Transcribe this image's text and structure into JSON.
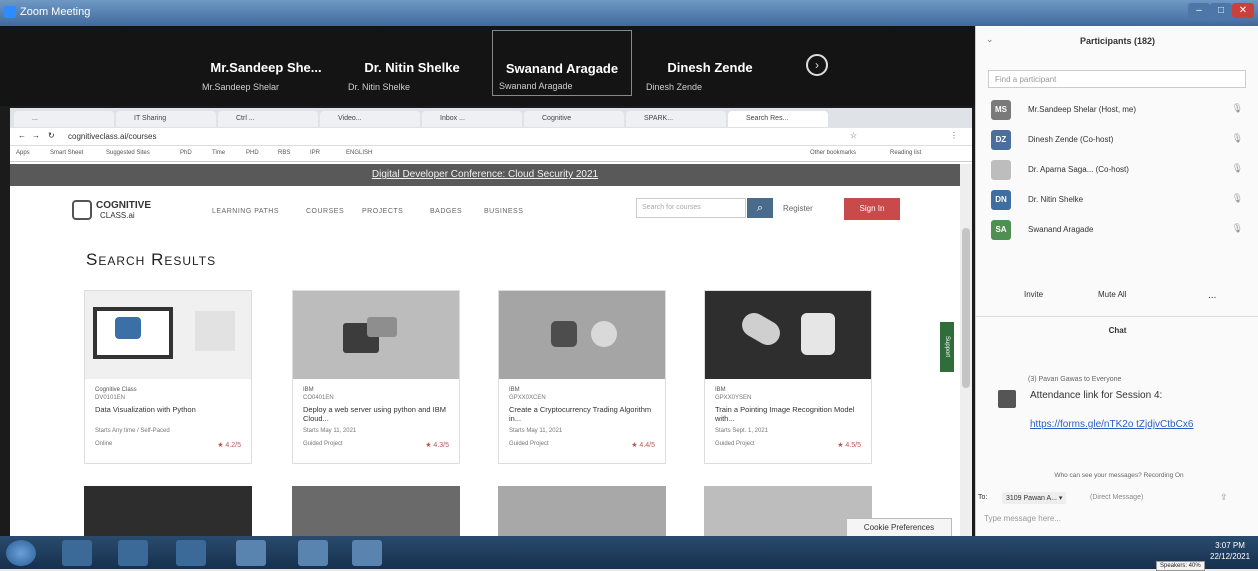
{
  "window": {
    "title": "Zoom Meeting"
  },
  "video_strip": {
    "tiles": [
      {
        "name": "Mr.Sandeep  She...",
        "sub": "Mr.Sandeep Shelar"
      },
      {
        "name": "Dr. Nitin Shelke",
        "sub": "Dr. Nitin Shelke"
      },
      {
        "name": "Swanand Aragade",
        "sub": "Swanand Aragade"
      },
      {
        "name": "Dinesh Zende",
        "sub": "Dinesh Zende"
      }
    ],
    "next_icon": "chevron-right-icon"
  },
  "browser": {
    "tabs": [
      "... ",
      "IT Sharing",
      "Ctrl ...",
      "Video...",
      "Inbox ...",
      "Cognitive",
      "SPARK...",
      "Search Res..."
    ],
    "address": "cognitiveclass.ai/courses",
    "bookmarks": [
      "Apps",
      "Smart Sheet",
      "Suggested Sites",
      "PhD",
      "Time",
      "PHD",
      "RBS",
      "IPR",
      "ENGLISH",
      "Other bookmarks",
      "Reading list"
    ]
  },
  "site": {
    "banner": "Digital Developer Conference: Cloud Security 2021",
    "logo_line1": "COGNITIVE",
    "logo_line2": "CLASS.ai",
    "nav": [
      "LEARNING PATHS",
      "COURSES",
      "PROJECTS",
      "BADGES",
      "BUSINESS"
    ],
    "search_placeholder": "Search for courses",
    "register": "Register",
    "signin": "Sign In",
    "results_title": "Search Results",
    "support": "Support",
    "cookie": "Cookie Preferences"
  },
  "cards": [
    {
      "provider": "Cognitive Class",
      "code": "DV0101EN",
      "title": "Data Visualization with Python",
      "date": "Starts Any time / Self-Paced",
      "foot": "Online",
      "rating": "★ 4.2/5"
    },
    {
      "provider": "IBM",
      "code": "CO0401EN",
      "title": "Deploy a web server using python and IBM Cloud...",
      "date": "Starts May 11, 2021",
      "foot": "Guided Project",
      "rating": "★ 4.3/5"
    },
    {
      "provider": "IBM",
      "code": "GPXX0XCEN",
      "title": "Create a Cryptocurrency Trading Algorithm in...",
      "date": "Starts May 11, 2021",
      "foot": "Guided Project",
      "rating": "★ 4.4/5"
    },
    {
      "provider": "IBM",
      "code": "GPXX0YSEN",
      "title": "Train a Pointing Image Recognition Model with...",
      "date": "Starts Sept. 1, 2021",
      "foot": "Guided Project",
      "rating": "★ 4.5/5"
    }
  ],
  "participants": {
    "header": "Participants (182)",
    "search_placeholder": "Find a participant",
    "list": [
      {
        "initials": "MS",
        "name": "Mr.Sandeep Shelar (Host, me)",
        "color": "#7a7a7a"
      },
      {
        "initials": "DZ",
        "name": "Dinesh Zende (Co-host)",
        "color": "#4a6f9c"
      },
      {
        "initials": "",
        "name": "Dr. Aparna Saga... (Co-host)",
        "color": "#bdbdbd"
      },
      {
        "initials": "DN",
        "name": "Dr. Nitin Shelke",
        "color": "#3f6ea3"
      },
      {
        "initials": "SA",
        "name": "Swanand Aragade",
        "color": "#4f8f52"
      }
    ],
    "invite": "Invite",
    "mute_all": "Mute All",
    "more": "..."
  },
  "chat": {
    "header": "Chat",
    "from": "(3) Pavan Gawas to Everyone",
    "message": "Attendance link for Session 4:",
    "link": "https://forms.gle/nTK2o tZjdjvCtbCx6",
    "note": "Who can see your messages? Recording On",
    "to_label": "To:",
    "to_value": "3109 Pawan A... ▾",
    "dm": "(Direct Message)",
    "placeholder": "Type message here..."
  },
  "taskbar": {
    "time": "3:07 PM",
    "date": "22/12/2021",
    "speakers": "Speakers: 40%"
  }
}
